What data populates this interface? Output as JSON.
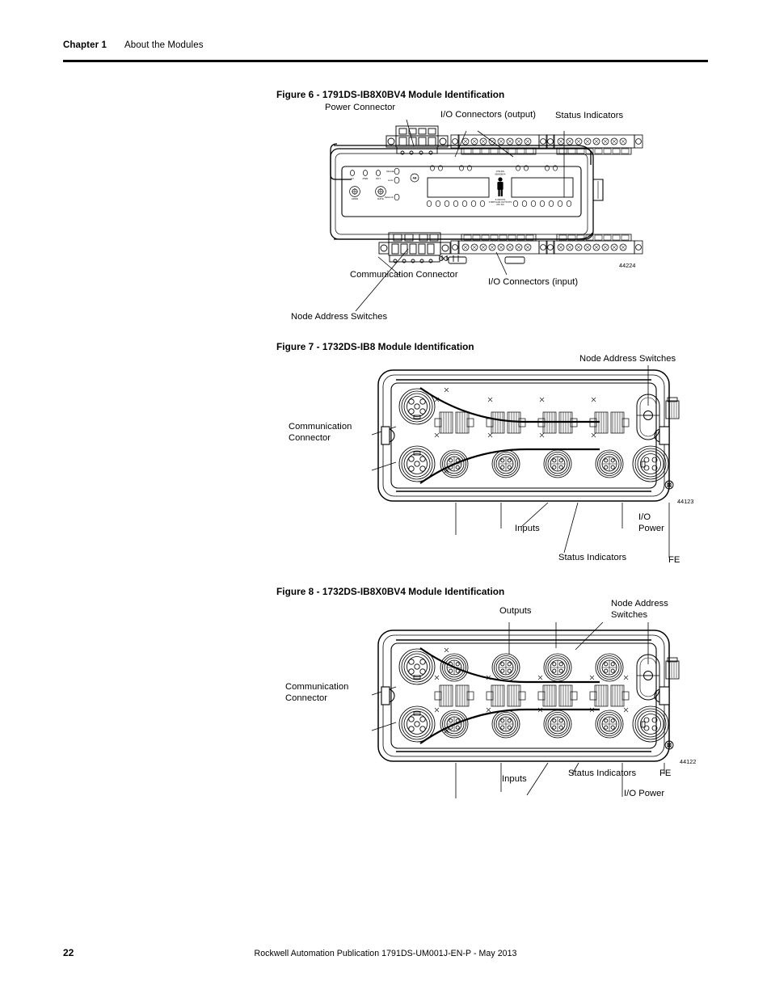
{
  "header": {
    "chapter": "Chapter 1",
    "title": "About the Modules"
  },
  "figures": [
    {
      "caption": "Figure 6 - 1791DS-IB8X0BV4 Module Identification",
      "figure_id": "44224",
      "callouts": [
        {
          "label": "Power Connector"
        },
        {
          "label": "I/O Connectors (output)"
        },
        {
          "label": "Status Indicators"
        },
        {
          "label": "Communication Connector"
        },
        {
          "label": "I/O Connectors (input)"
        },
        {
          "label": "Node Address Switches"
        }
      ]
    },
    {
      "caption": "Figure 7 -  1732DS-IB8 Module Identification",
      "figure_id": "44123",
      "callouts": [
        {
          "label": "Node Address Switches"
        },
        {
          "label_line1": "Communication",
          "label_line2": "Connector"
        },
        {
          "label": "Inputs"
        },
        {
          "label": "Status Indicators"
        },
        {
          "label_line1": "I/O",
          "label_line2": "Power"
        },
        {
          "label": "FE"
        }
      ]
    },
    {
      "caption": "Figure 8 - 1732DS-IB8X0BV4 Module Identification",
      "figure_id": "44122",
      "callouts": [
        {
          "label": "Outputs"
        },
        {
          "label_line1": "Node Address",
          "label_line2": "Switches"
        },
        {
          "label_line1": "Communication",
          "label_line2": "Connector"
        },
        {
          "label": "Inputs"
        },
        {
          "label": "Status Indicators"
        },
        {
          "label": "FE"
        },
        {
          "label": "I/O Power"
        }
      ]
    }
  ],
  "module_panel_text": {
    "brand": "AB",
    "center_top": "1791DS-",
    "center_top2": "IB8X0BV4",
    "center_bottom1": "8 INPUTS",
    "center_bottom2": "4 BIPOLAR OUTPUTS",
    "center_bottom3": "24V DC",
    "led_labels": [
      "IN",
      "PWR",
      "OUT",
      "Module",
      "Lock",
      "Network"
    ]
  },
  "footer": {
    "page_number": "22",
    "publication": "Rockwell Automation Publication 1791DS-UM001J-EN-P - May 2013"
  },
  "colors": {
    "ink": "#000000",
    "paper": "#ffffff"
  }
}
